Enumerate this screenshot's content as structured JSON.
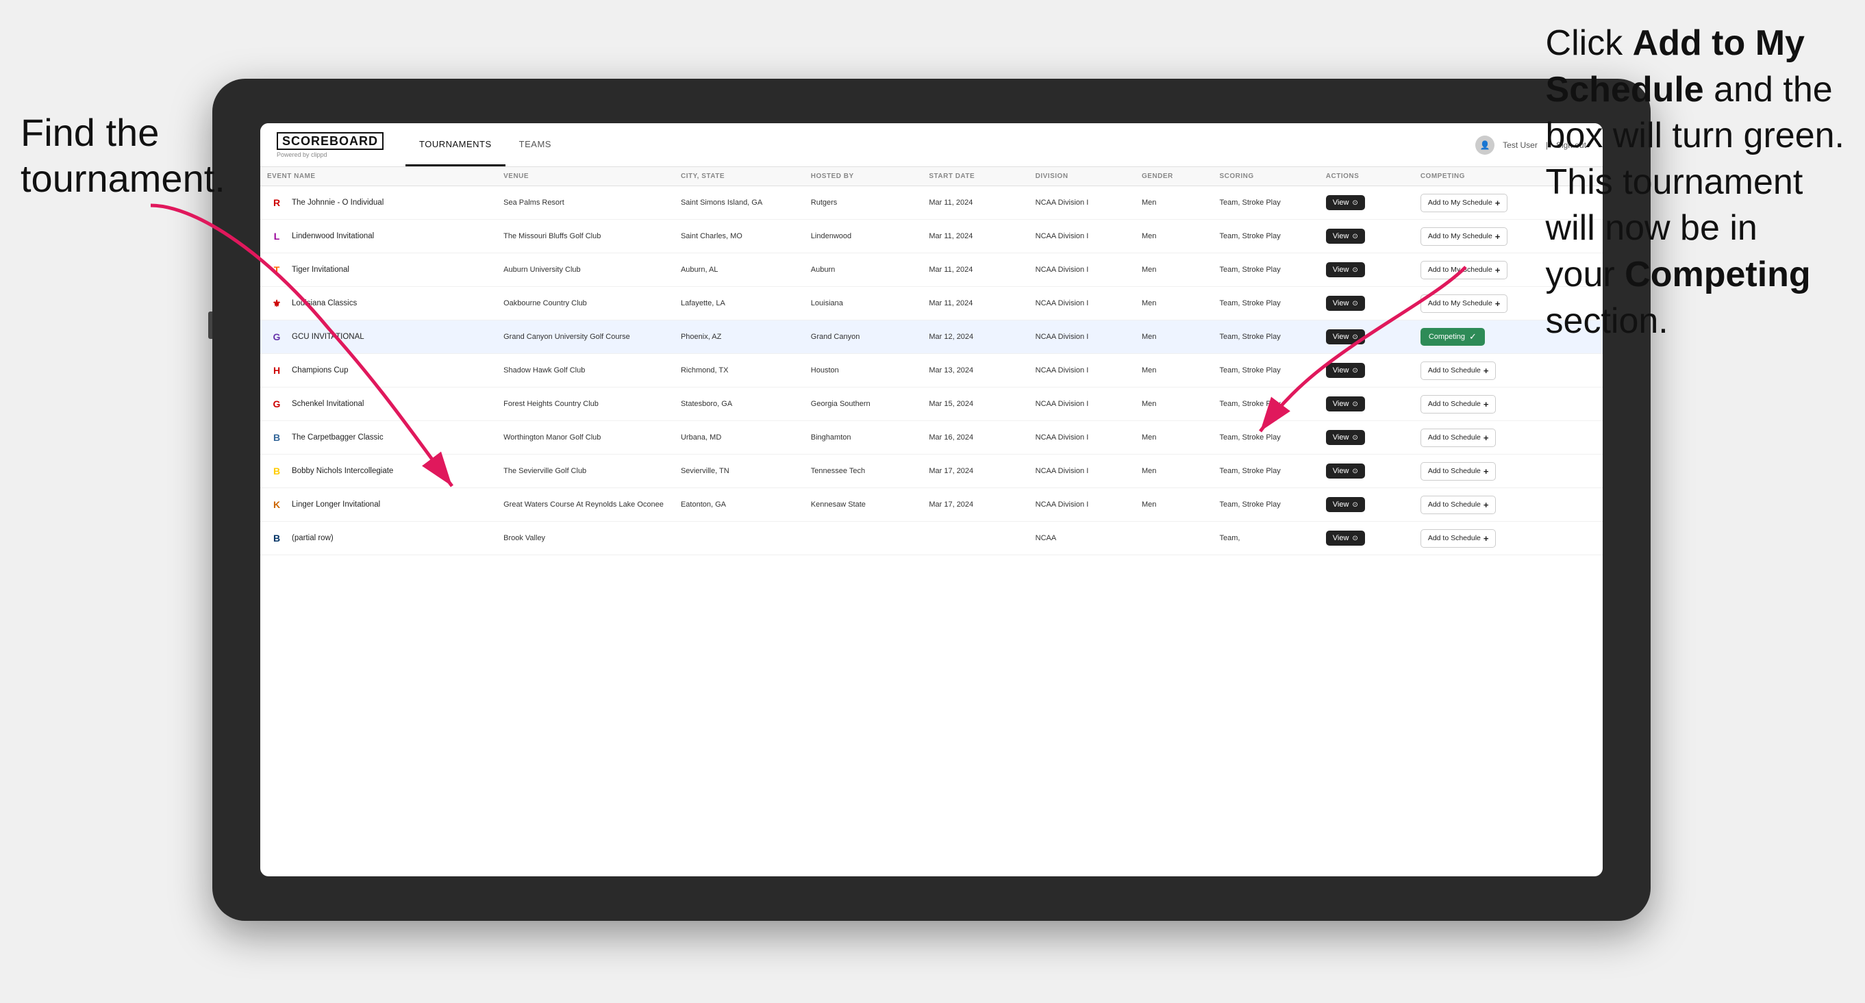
{
  "annotations": {
    "left": "Find the\ntournament.",
    "right_part1": "Click ",
    "right_bold1": "Add to My\nSchedule",
    "right_part2": " and the\nbox will turn green.\nThis tournament\nwill now be in\nyour ",
    "right_bold2": "Competing",
    "right_part3": "\nsection."
  },
  "header": {
    "logo": "SCOREBOARD",
    "logo_sub": "Powered by clippd",
    "nav": [
      "TOURNAMENTS",
      "TEAMS"
    ],
    "active_nav": "TOURNAMENTS",
    "user": "Test User",
    "sign_out": "Sign out"
  },
  "table": {
    "columns": [
      "EVENT NAME",
      "VENUE",
      "CITY, STATE",
      "HOSTED BY",
      "START DATE",
      "DIVISION",
      "GENDER",
      "SCORING",
      "ACTIONS",
      "COMPETING"
    ],
    "rows": [
      {
        "logo_letter": "R",
        "logo_color": "#cc0000",
        "event": "The Johnnie - O Individual",
        "venue": "Sea Palms Resort",
        "city_state": "Saint Simons Island, GA",
        "hosted_by": "Rutgers",
        "start_date": "Mar 11, 2024",
        "division": "NCAA Division I",
        "gender": "Men",
        "scoring": "Team, Stroke Play",
        "action": "View",
        "competing_status": "add",
        "competing_label": "Add to My Schedule",
        "highlighted": false
      },
      {
        "logo_letter": "L",
        "logo_color": "#990099",
        "event": "Lindenwood Invitational",
        "venue": "The Missouri Bluffs Golf Club",
        "city_state": "Saint Charles, MO",
        "hosted_by": "Lindenwood",
        "start_date": "Mar 11, 2024",
        "division": "NCAA Division I",
        "gender": "Men",
        "scoring": "Team, Stroke Play",
        "action": "View",
        "competing_status": "add",
        "competing_label": "Add to My Schedule",
        "highlighted": false
      },
      {
        "logo_letter": "T",
        "logo_color": "#ff6600",
        "event": "Tiger Invitational",
        "venue": "Auburn University Club",
        "city_state": "Auburn, AL",
        "hosted_by": "Auburn",
        "start_date": "Mar 11, 2024",
        "division": "NCAA Division I",
        "gender": "Men",
        "scoring": "Team, Stroke Play",
        "action": "View",
        "competing_status": "add",
        "competing_label": "Add to My Schedule",
        "highlighted": false
      },
      {
        "logo_letter": "⚜",
        "logo_color": "#cc0000",
        "event": "Louisiana Classics",
        "venue": "Oakbourne Country Club",
        "city_state": "Lafayette, LA",
        "hosted_by": "Louisiana",
        "start_date": "Mar 11, 2024",
        "division": "NCAA Division I",
        "gender": "Men",
        "scoring": "Team, Stroke Play",
        "action": "View",
        "competing_status": "add",
        "competing_label": "Add to My Schedule",
        "highlighted": false
      },
      {
        "logo_letter": "G",
        "logo_color": "#6633aa",
        "event": "GCU INVITATIONAL",
        "venue": "Grand Canyon University Golf Course",
        "city_state": "Phoenix, AZ",
        "hosted_by": "Grand Canyon",
        "start_date": "Mar 12, 2024",
        "division": "NCAA Division I",
        "gender": "Men",
        "scoring": "Team, Stroke Play",
        "action": "View",
        "competing_status": "competing",
        "competing_label": "Competing",
        "highlighted": true
      },
      {
        "logo_letter": "H",
        "logo_color": "#cc0000",
        "event": "Champions Cup",
        "venue": "Shadow Hawk Golf Club",
        "city_state": "Richmond, TX",
        "hosted_by": "Houston",
        "start_date": "Mar 13, 2024",
        "division": "NCAA Division I",
        "gender": "Men",
        "scoring": "Team, Stroke Play",
        "action": "View",
        "competing_status": "add",
        "competing_label": "Add to Schedule",
        "highlighted": false
      },
      {
        "logo_letter": "G",
        "logo_color": "#cc0000",
        "event": "Schenkel Invitational",
        "venue": "Forest Heights Country Club",
        "city_state": "Statesboro, GA",
        "hosted_by": "Georgia Southern",
        "start_date": "Mar 15, 2024",
        "division": "NCAA Division I",
        "gender": "Men",
        "scoring": "Team, Stroke Play",
        "action": "View",
        "competing_status": "add",
        "competing_label": "Add to Schedule",
        "highlighted": false
      },
      {
        "logo_letter": "B",
        "logo_color": "#336699",
        "event": "The Carpetbagger Classic",
        "venue": "Worthington Manor Golf Club",
        "city_state": "Urbana, MD",
        "hosted_by": "Binghamton",
        "start_date": "Mar 16, 2024",
        "division": "NCAA Division I",
        "gender": "Men",
        "scoring": "Team, Stroke Play",
        "action": "View",
        "competing_status": "add",
        "competing_label": "Add to Schedule",
        "highlighted": false
      },
      {
        "logo_letter": "B",
        "logo_color": "#ffcc00",
        "event": "Bobby Nichols Intercollegiate",
        "venue": "The Sevierville Golf Club",
        "city_state": "Sevierville, TN",
        "hosted_by": "Tennessee Tech",
        "start_date": "Mar 17, 2024",
        "division": "NCAA Division I",
        "gender": "Men",
        "scoring": "Team, Stroke Play",
        "action": "View",
        "competing_status": "add",
        "competing_label": "Add to Schedule",
        "highlighted": false
      },
      {
        "logo_letter": "K",
        "logo_color": "#cc6600",
        "event": "Linger Longer Invitational",
        "venue": "Great Waters Course At Reynolds Lake Oconee",
        "city_state": "Eatonton, GA",
        "hosted_by": "Kennesaw State",
        "start_date": "Mar 17, 2024",
        "division": "NCAA Division I",
        "gender": "Men",
        "scoring": "Team, Stroke Play",
        "action": "View",
        "competing_status": "add",
        "competing_label": "Add to Schedule",
        "highlighted": false
      },
      {
        "logo_letter": "B",
        "logo_color": "#003366",
        "event": "(partial row)",
        "venue": "Brook Valley",
        "city_state": "",
        "hosted_by": "",
        "start_date": "",
        "division": "NCAA",
        "gender": "",
        "scoring": "Team,",
        "action": "View",
        "competing_status": "add",
        "competing_label": "Add to Schedule",
        "highlighted": false
      }
    ]
  }
}
